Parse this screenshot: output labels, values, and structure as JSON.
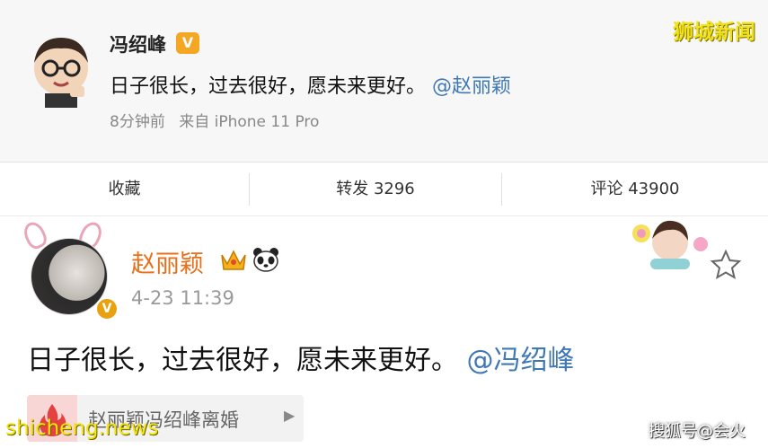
{
  "post1": {
    "author": "冯绍峰",
    "verified_badge": "V",
    "text": "日子很长，过去很好，愿未来更好。",
    "mention": "@赵丽颖",
    "time": "8分钟前",
    "source": "来自 iPhone 11 Pro",
    "avatar_icon": "cartoon-avatar-icon"
  },
  "actions": {
    "favorite": "收藏",
    "repost": "转发 3296",
    "comment": "评论 43900"
  },
  "post2": {
    "author": "赵丽颖",
    "verified_badge": "V",
    "time": "4-23 11:39",
    "text": "日子很长，过去很好，愿未来更好。",
    "mention": "@冯绍峰",
    "topic": "赵丽颖冯绍峰离婚",
    "icons": [
      "crown-icon",
      "panda-icon",
      "star-icon",
      "fire-icon"
    ]
  },
  "watermarks": {
    "top_right": "狮城新闻",
    "bottom_left": "shicheng.news",
    "bottom_right": "搜狐号@会火"
  },
  "colors": {
    "mention": "#3f78b5",
    "author2": "#e8701a",
    "verified": "#f5a623",
    "watermark": "#f2e21a"
  }
}
